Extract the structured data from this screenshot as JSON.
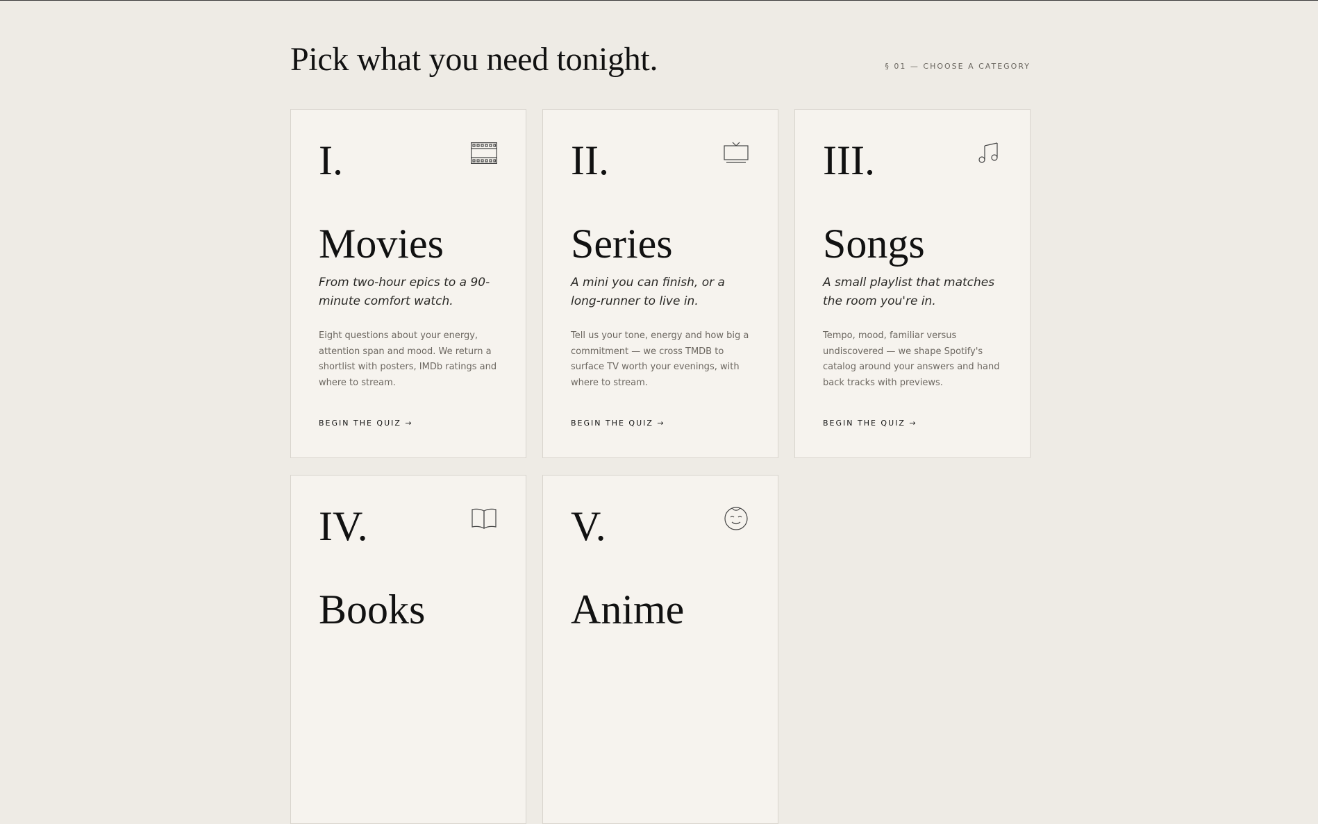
{
  "header": {
    "title": "Pick what you need tonight.",
    "section_label": "§ 01 — CHOOSE A CATEGORY"
  },
  "cards": [
    {
      "numeral": "I.",
      "icon": "film-icon",
      "title": "Movies",
      "tagline": "From two-hour epics to a 90-minute comfort watch.",
      "description": "Eight questions about your energy, attention span and mood. We return a shortlist with posters, IMDb ratings and where to stream.",
      "cta": "BEGIN THE QUIZ →"
    },
    {
      "numeral": "II.",
      "icon": "tv-icon",
      "title": "Series",
      "tagline": "A mini you can finish, or a long-runner to live in.",
      "description": "Tell us your tone, energy and how big a commitment — we cross TMDB to surface TV worth your evenings, with where to stream.",
      "cta": "BEGIN THE QUIZ →"
    },
    {
      "numeral": "III.",
      "icon": "music-note-icon",
      "title": "Songs",
      "tagline": "A small playlist that matches the room you're in.",
      "description": "Tempo, mood, familiar versus undiscovered — we shape Spotify's catalog around your answers and hand back tracks with previews.",
      "cta": "BEGIN THE QUIZ →"
    },
    {
      "numeral": "IV.",
      "icon": "open-book-icon",
      "title": "Books",
      "tagline": "",
      "description": "",
      "cta": ""
    },
    {
      "numeral": "V.",
      "icon": "anime-face-icon",
      "title": "Anime",
      "tagline": "",
      "description": "",
      "cta": ""
    }
  ]
}
